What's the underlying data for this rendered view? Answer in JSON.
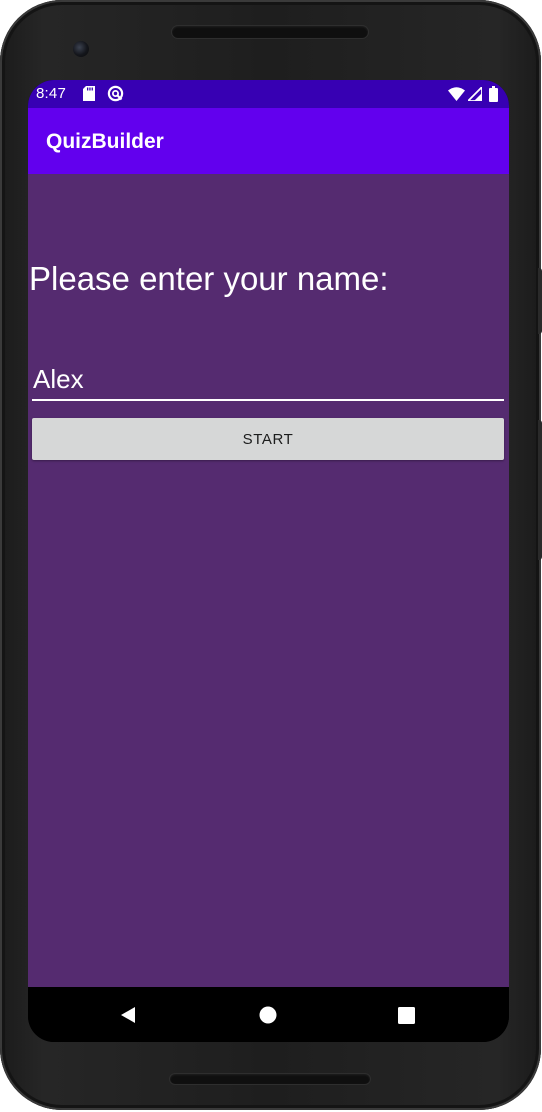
{
  "status_bar": {
    "time": "8:47",
    "left_icons": [
      "sd-card-icon",
      "sync-icon"
    ],
    "right_icons": [
      "wifi-icon",
      "signal-icon",
      "battery-icon"
    ],
    "color": "#3700b3"
  },
  "app_bar": {
    "title": "QuizBuilder",
    "color": "#6200ee"
  },
  "main": {
    "background": "#552b70",
    "prompt": "Please enter your name:",
    "name_input": {
      "value": "Alex",
      "placeholder": ""
    },
    "start_button": {
      "label": "START"
    }
  },
  "nav_bar": {
    "buttons": [
      "back-icon",
      "home-icon",
      "recents-icon"
    ]
  }
}
